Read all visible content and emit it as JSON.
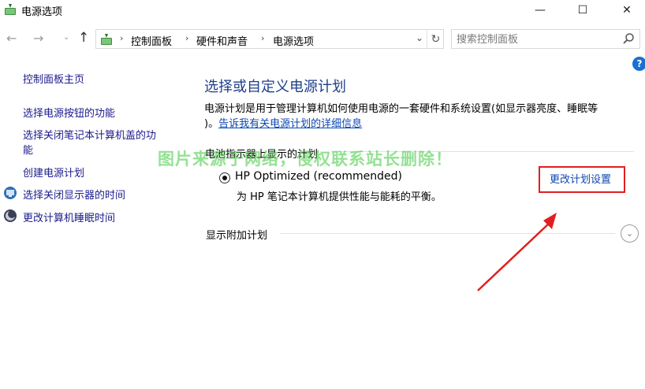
{
  "window": {
    "title": "电源选项",
    "minimize_glyph": "—",
    "maximize_glyph": "☐",
    "close_glyph": "✕"
  },
  "nav": {
    "back_glyph": "←",
    "forward_glyph": "→",
    "recent_glyph": "⌄",
    "up_glyph": "↑",
    "breadcrumb": [
      "控制面板",
      "硬件和声音",
      "电源选项"
    ],
    "separator_glyph": "›",
    "dropdown_glyph": "⌄",
    "refresh_glyph": "↻"
  },
  "search": {
    "placeholder": "搜索控制面板"
  },
  "help_glyph": "?",
  "sidebar": {
    "items": [
      {
        "label": "控制面板主页"
      },
      {
        "label": "选择电源按钮的功能"
      },
      {
        "label": "选择关闭笔记本计算机盖的功",
        "label_line2": "能"
      },
      {
        "label": "创建电源计划"
      },
      {
        "label": "选择关闭显示器的时间",
        "icon": "monitor-icon"
      },
      {
        "label": "更改计算机睡眠时间",
        "icon": "moon-icon"
      }
    ]
  },
  "main": {
    "title": "选择或自定义电源计划",
    "description_line1": "电源计划是用于管理计算机如何使用电源的一套硬件和系统设置(如显示器亮度、睡眠等",
    "description_line2_prefix": ")。",
    "description_link": "告诉我有关电源计划的详细信息",
    "section_heading": "电池指示器上显示的计划",
    "plan": {
      "name": "HP Optimized (recommended)",
      "description": "为 HP 笔记本计算机提供性能与能耗的平衡。",
      "selected": true,
      "change_link": "更改计划设置"
    },
    "more_plans_label": "显示附加计划",
    "expand_glyph": "⌄"
  },
  "watermark": "图片来源于网络，侵权联系站长删除！",
  "colors": {
    "accent_link": "#0d47b3",
    "title_blue": "#1e3f8a",
    "highlight_red": "#e02020",
    "watermark_green": "#3cc83c"
  }
}
